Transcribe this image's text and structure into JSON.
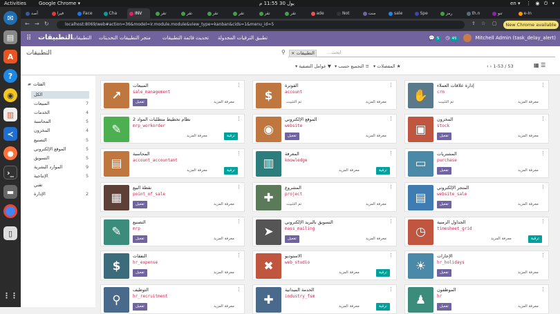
{
  "topbar": {
    "activities": "Activities",
    "app": "Google Chrome ▾",
    "clock": "يول 30 11:55 م",
    "lang": "en ▾",
    "sys": "⋮ ◉ ⏻ ▾"
  },
  "tabs": [
    "أصد",
    "فيرا",
    "Face",
    "Cha",
    "INV",
    "تقر",
    "تقر",
    "تقر",
    "تقر",
    "تقر",
    "تقر",
    "ade",
    "Not",
    "منت",
    "sale",
    "Spe",
    "رمز",
    "th.n",
    "تنو",
    "e-In"
  ],
  "address": {
    "url": "localhost:8069/web#action=36&model=ir.module.module&view_type=kanban&cids=1&menu_id=5",
    "update": "New Chrome available ⋮"
  },
  "nav": {
    "brand": "التطبيقات",
    "menu": [
      "التطبيقات",
      "التحديثات",
      "متجر التطبيقات",
      "تحديث قائمة التطبيقات",
      "تطبيق الترقيات المجدولة"
    ],
    "user": "Mitchell Admin (task_delay_alert)",
    "msg_count": "5",
    "act_count": "45"
  },
  "control": {
    "title": "التطبيقات",
    "facet": "التطبيقات",
    "search_placeholder": "...ابحث",
    "filters": "عوامل التصفية",
    "group_by": "التجميع حسب",
    "favorites": "المفضلات",
    "pager": "1-53 / 53"
  },
  "sidebar": {
    "heading": "الفئات",
    "items": [
      {
        "name": "الكل",
        "count": ""
      },
      {
        "name": "المبيعات",
        "count": "7"
      },
      {
        "name": "الخدمات",
        "count": "4"
      },
      {
        "name": "المحاسبة",
        "count": "5"
      },
      {
        "name": "المخزون",
        "count": "4"
      },
      {
        "name": "التصنيع",
        "count": "5"
      },
      {
        "name": "الموقع الإلكتروني",
        "count": "5"
      },
      {
        "name": "التسويق",
        "count": "5"
      },
      {
        "name": "الموارد البشرية",
        "count": "9"
      },
      {
        "name": "الإنتاجية",
        "count": "5"
      },
      {
        "name": "تقني",
        "count": ""
      },
      {
        "name": "الإدارة",
        "count": "2"
      }
    ]
  },
  "labels": {
    "activate": "تفعيل",
    "upgrade": "ترقية",
    "installed": "تم التثبيت",
    "learn": "معرفة المزيد"
  },
  "apps": [
    {
      "name": "المبيعات",
      "tech": "sale_management",
      "state": "activate",
      "color": "#c0763f",
      "icon": "↗"
    },
    {
      "name": "الفوترة",
      "tech": "account",
      "state": "installed",
      "color": "#c0763f",
      "icon": "$"
    },
    {
      "name": "إدارة علاقات العملاء",
      "tech": "crm",
      "state": "installed",
      "color": "#5a7a8c",
      "icon": "✋"
    },
    {
      "name": "نظام تخطيط متطلبات المواد 2",
      "tech": "mrp_workorder",
      "state": "upgrade",
      "color": "#4caf50",
      "icon": "✎"
    },
    {
      "name": "الموقع الإلكتروني",
      "tech": "website",
      "state": "activate",
      "color": "#c0763f",
      "icon": "◉"
    },
    {
      "name": "المخزون",
      "tech": "stock",
      "state": "activate",
      "color": "#c0563f",
      "icon": "▣"
    },
    {
      "name": "المحاسبة",
      "tech": "account_accountant",
      "state": "upgrade",
      "color": "#c0763f",
      "icon": "▤"
    },
    {
      "name": "المعرفة",
      "tech": "knowledge",
      "state": "upgrade",
      "color": "#2e7d7d",
      "icon": "▥"
    },
    {
      "name": "المشتريات",
      "tech": "purchase",
      "state": "activate",
      "color": "#4a8aa8",
      "icon": "▭"
    },
    {
      "name": "نقطة البيع",
      "tech": "point_of_sale",
      "state": "activate",
      "color": "#5d4037",
      "icon": "▦"
    },
    {
      "name": "المشروع",
      "tech": "project",
      "state": "installed",
      "color": "#5a7a5a",
      "icon": "✚"
    },
    {
      "name": "المتجر الإلكتروني",
      "tech": "website_sale",
      "state": "activate",
      "color": "#3e7cb1",
      "icon": "▤"
    },
    {
      "name": "التصنيع",
      "tech": "mrp",
      "state": "activate",
      "color": "#3c8c7c",
      "icon": "✎"
    },
    {
      "name": "التسويق بالبريد الإلكتروني",
      "tech": "mass_mailing",
      "state": "activate",
      "color": "#555555",
      "icon": "➤"
    },
    {
      "name": "الجداول الزمنية",
      "tech": "timesheet_grid",
      "state": "upgrade",
      "color": "#c0563f",
      "icon": "◷"
    },
    {
      "name": "النفقات",
      "tech": "hr_expense",
      "state": "activate",
      "color": "#3c6c7c",
      "icon": "$"
    },
    {
      "name": "الاستوديو",
      "tech": "web_studio",
      "state": "upgrade",
      "color": "#c0563f",
      "icon": "✖"
    },
    {
      "name": "الإجازات",
      "tech": "hr_holidays",
      "state": "activate",
      "color": "#4a8aa8",
      "icon": "☀"
    },
    {
      "name": "التوظيف",
      "tech": "hr_recruitment",
      "state": "activate",
      "color": "#4a6a8c",
      "icon": "⚲"
    },
    {
      "name": "الخدمة الميدانية",
      "tech": "industry_fsm",
      "state": "upgrade",
      "color": "#4a6a8c",
      "icon": "✚"
    },
    {
      "name": "الموظفون",
      "tech": "hr",
      "state": "activate",
      "color": "#3c8c7c",
      "icon": "♟"
    }
  ]
}
